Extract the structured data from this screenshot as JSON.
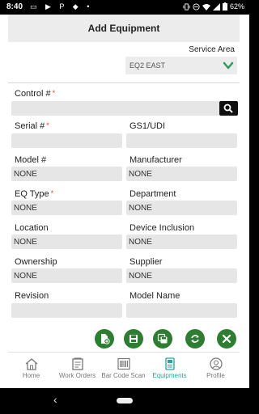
{
  "status_bar": {
    "time": "8:40",
    "icons": "▭ ▶ P ◆ •",
    "battery": "62%"
  },
  "header": {
    "title": "Add Equipment"
  },
  "service_area": {
    "label": "Service Area",
    "value": "EQ2 EAST"
  },
  "form": {
    "control": {
      "label": "Control #",
      "required_mark": "*",
      "value": ""
    },
    "serial": {
      "label": "Serial #",
      "required_mark": "*",
      "value": ""
    },
    "gs1": {
      "label": "GS1/UDI",
      "value": ""
    },
    "model": {
      "label": "Model #",
      "value": "NONE"
    },
    "manufacturer": {
      "label": "Manufacturer",
      "value": "NONE"
    },
    "eq_type": {
      "label": "EQ Type",
      "required_mark": "*",
      "value": "NONE"
    },
    "department": {
      "label": "Department",
      "value": "NONE"
    },
    "location": {
      "label": "Location",
      "value": "NONE"
    },
    "device_inclusion": {
      "label": "Device Inclusion",
      "value": "NONE"
    },
    "ownership": {
      "label": "Ownership",
      "value": "NONE"
    },
    "supplier": {
      "label": "Supplier",
      "value": "NONE"
    },
    "revision": {
      "label": "Revision",
      "value": ""
    },
    "model_name": {
      "label": "Model Name",
      "value": ""
    }
  },
  "actions": [
    "add-document-icon",
    "save-icon",
    "save-copy-icon",
    "refresh-icon",
    "close-icon"
  ],
  "tabs": [
    {
      "label": "Home",
      "icon": "home-icon"
    },
    {
      "label": "Work Orders",
      "icon": "work-orders-icon"
    },
    {
      "label": "Bar Code Scan",
      "icon": "barcode-icon"
    },
    {
      "label": "Equipments",
      "icon": "equipments-icon",
      "active": true
    },
    {
      "label": "Profile",
      "icon": "profile-icon"
    }
  ],
  "colors": {
    "accent": "#26a69a",
    "action_green": "#2e7d32",
    "required": "#e53935"
  }
}
